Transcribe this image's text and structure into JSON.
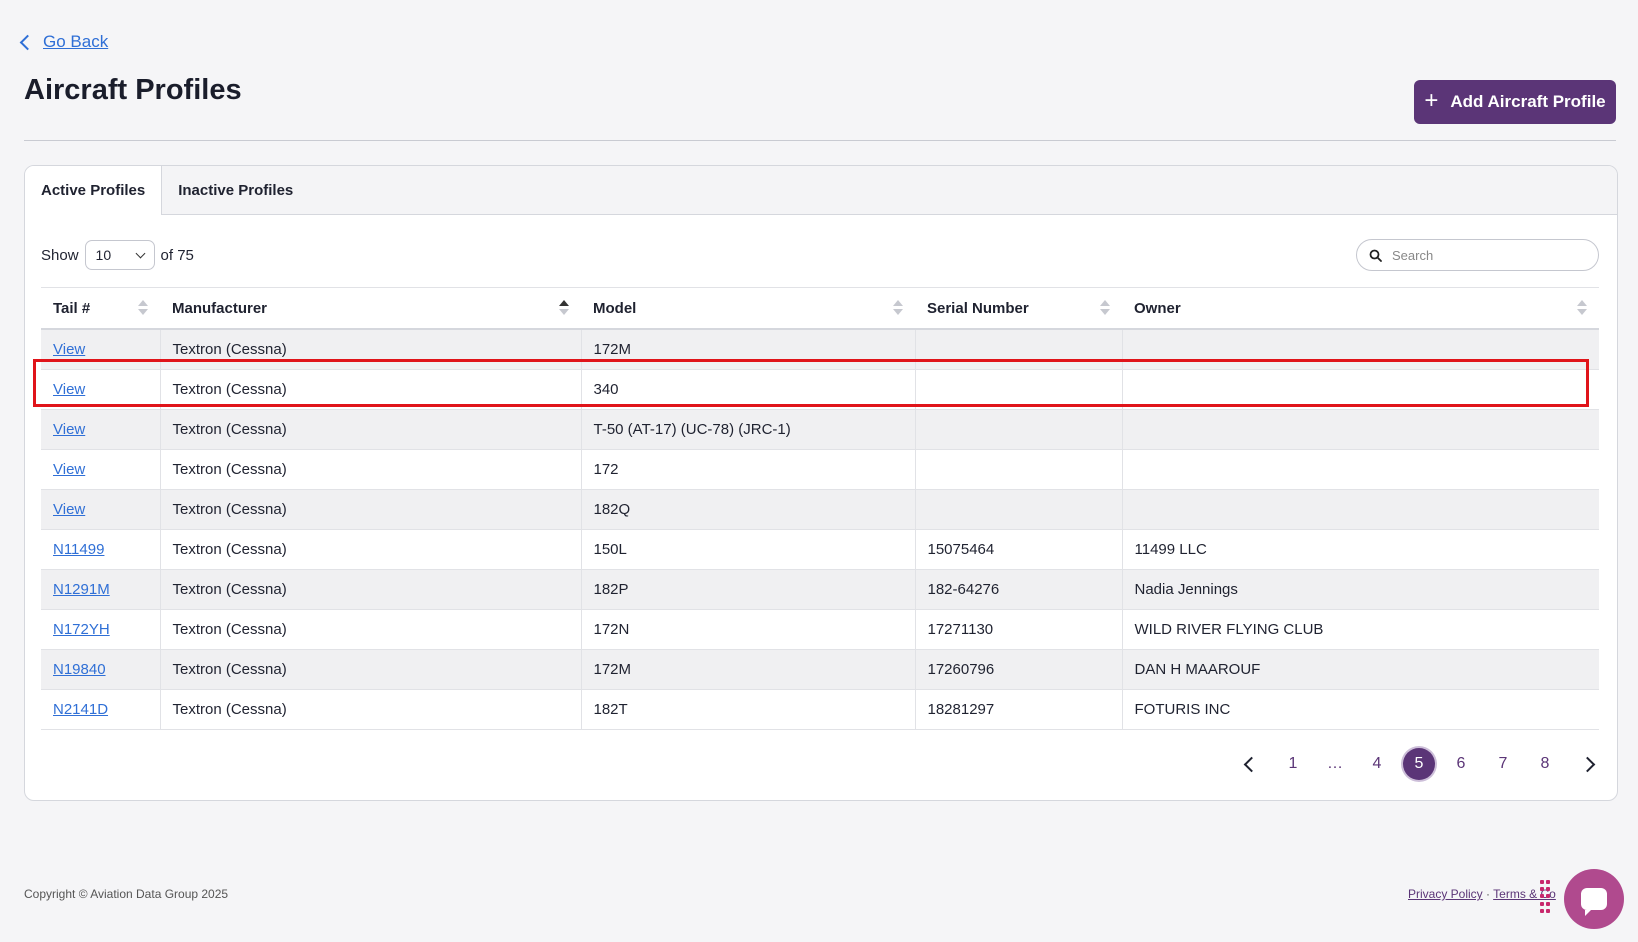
{
  "nav": {
    "go_back": "Go Back"
  },
  "header": {
    "title": "Aircraft Profiles",
    "add_button": "Add Aircraft Profile"
  },
  "tabs": [
    {
      "label": "Active Profiles",
      "active": true
    },
    {
      "label": "Inactive Profiles",
      "active": false
    }
  ],
  "controls": {
    "show_label": "Show",
    "page_size": "10",
    "total_text": "of 75",
    "search_placeholder": "Search"
  },
  "table": {
    "columns": [
      "Tail #",
      "Manufacturer",
      "Model",
      "Serial Number",
      "Owner"
    ],
    "sorted_column": "Manufacturer",
    "rows": [
      {
        "tail": "View",
        "manufacturer": "Textron (Cessna)",
        "model": "172M",
        "serial": "",
        "owner": ""
      },
      {
        "tail": "View",
        "manufacturer": "Textron (Cessna)",
        "model": "340",
        "serial": "",
        "owner": ""
      },
      {
        "tail": "View",
        "manufacturer": "Textron (Cessna)",
        "model": "T-50 (AT-17) (UC-78) (JRC-1)",
        "serial": "",
        "owner": ""
      },
      {
        "tail": "View",
        "manufacturer": "Textron (Cessna)",
        "model": "172",
        "serial": "",
        "owner": ""
      },
      {
        "tail": "View",
        "manufacturer": "Textron (Cessna)",
        "model": "182Q",
        "serial": "",
        "owner": ""
      },
      {
        "tail": "N11499",
        "manufacturer": "Textron (Cessna)",
        "model": "150L",
        "serial": "15075464",
        "owner": "11499 LLC"
      },
      {
        "tail": "N1291M",
        "manufacturer": "Textron (Cessna)",
        "model": "182P",
        "serial": "182-64276",
        "owner": "Nadia Jennings"
      },
      {
        "tail": "N172YH",
        "manufacturer": "Textron (Cessna)",
        "model": "172N",
        "serial": "17271130",
        "owner": "WILD RIVER FLYING CLUB"
      },
      {
        "tail": "N19840",
        "manufacturer": "Textron (Cessna)",
        "model": "172M",
        "serial": "17260796",
        "owner": "DAN H MAAROUF"
      },
      {
        "tail": "N2141D",
        "manufacturer": "Textron (Cessna)",
        "model": "182T",
        "serial": "18281297",
        "owner": "FOTURIS INC"
      }
    ],
    "highlighted_row": 2
  },
  "pagination": {
    "pages": [
      "1",
      "…",
      "4",
      "5",
      "6",
      "7",
      "8"
    ],
    "current": "5"
  },
  "footer": {
    "copyright": "Copyright © Aviation Data Group 2025",
    "privacy": "Privacy Policy",
    "separator": "·",
    "terms": "Terms & Co"
  },
  "colors": {
    "accent": "#5b3577",
    "link": "#2f6fd6",
    "highlight": "#e0141a",
    "chat": "#b04a8e"
  },
  "icons": {
    "back": "chevron-left-icon",
    "add": "plus-icon",
    "search": "search-icon",
    "chat": "chat-bubble-icon"
  }
}
